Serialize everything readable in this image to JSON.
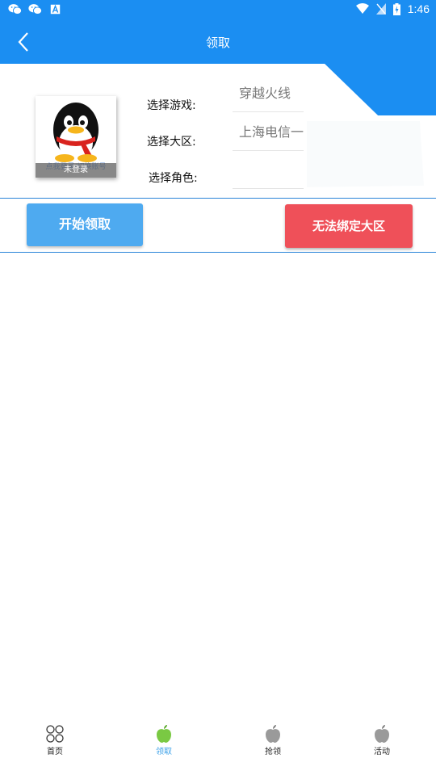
{
  "status_bar": {
    "time": "1:46"
  },
  "header": {
    "title": "领取"
  },
  "avatar": {
    "caption_top": "点我登录/切换账号",
    "caption_bottom": "未登录"
  },
  "form": {
    "game_label": "选择游戏:",
    "game_value": "穿越火线",
    "region_label": "选择大区:",
    "region_value": "上海电信一",
    "role_label": "选择角色:",
    "role_value": ""
  },
  "actions": {
    "start_label": "开始领取",
    "bind_label": "无法绑定大区"
  },
  "bottom_nav": {
    "items": [
      {
        "label": "首页",
        "icon": "grid-icon"
      },
      {
        "label": "领取",
        "icon": "apple-icon",
        "active": true
      },
      {
        "label": "抢领",
        "icon": "apple-icon"
      },
      {
        "label": "活动",
        "icon": "apple-icon"
      }
    ]
  },
  "colors": {
    "primary_blue": "#1b8ef2",
    "start_button": "#4eaaf0",
    "bind_button": "#ef5059",
    "active_tab": "#3aa0e8"
  }
}
